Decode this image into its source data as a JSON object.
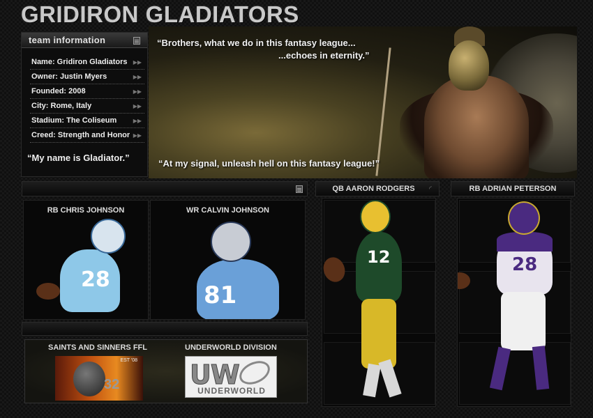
{
  "site": {
    "title": "GRIDIRON GLADIATORS"
  },
  "team_info": {
    "heading": "team information",
    "rows": [
      {
        "label": "Name: Gridiron Gladiators"
      },
      {
        "label": "Owner:  Justin Myers"
      },
      {
        "label": "Founded: 2008"
      },
      {
        "label": "City: Rome, Italy"
      },
      {
        "label": "Stadium: The Coliseum"
      },
      {
        "label": "Creed: Strength and Honor"
      }
    ],
    "motto": "“My name is Gladiator.”"
  },
  "banner": {
    "quote_line1": "“Brothers, what we do in this fantasy league...",
    "quote_line2": "...echoes in eternity.”",
    "quote_bottom": "“At my signal, unleash hell on this fantasy league!”"
  },
  "players": [
    {
      "title": "RB CHRIS JOHNSON",
      "number": "28",
      "jersey_color": "#8ec8e8",
      "helmet_color": "#d8e4ee"
    },
    {
      "title": "WR CALVIN JOHNSON",
      "number": "81",
      "jersey_color": "#6aa0d8",
      "helmet_color": "#c8ccd4"
    },
    {
      "title": "QB AARON RODGERS",
      "number": "12",
      "jersey_color": "#1e4a2a",
      "helmet_color": "#e8c030"
    },
    {
      "title": "RB ADRIAN PETERSON",
      "number": "28",
      "jersey_color": "#e8e4ee",
      "helmet_color": "#4a2a80"
    }
  ],
  "leagues": {
    "league1": {
      "title": "SAINTS AND SINNERS FFL",
      "est": "EST '08",
      "number": "32"
    },
    "league2": {
      "title": "UNDERWORLD DIVISION",
      "letters": "UW",
      "word": "UNDERWORLD"
    }
  },
  "icons": {
    "team_heading_icon": "document-icon",
    "row_icon": "double-arrow-icon",
    "section_icon": "document-icon",
    "feed_icon": "rss-icon"
  },
  "colors": {
    "background": "#0c0c0c",
    "title": "#c9c9c9",
    "text": "#eeeeee"
  }
}
